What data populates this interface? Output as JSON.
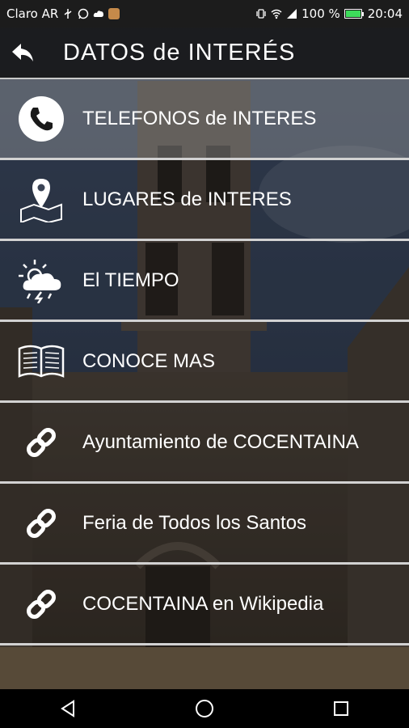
{
  "status_bar": {
    "carrier": "Claro AR",
    "battery_percent": "100 %",
    "battery_level": 1.0,
    "time": "20:04",
    "icons_left": [
      "usb-icon",
      "whatsapp-icon",
      "cloud-icon",
      "app-notification-icon"
    ],
    "icons_right": [
      "vibrate-icon",
      "wifi-icon",
      "signal-icon",
      "battery-icon"
    ]
  },
  "header": {
    "back_icon": "back-arrow-icon",
    "title": "DATOS de INTERÉS"
  },
  "menu": {
    "items": [
      {
        "icon": "phone-icon",
        "label": "TELEFONOS de INTERES"
      },
      {
        "icon": "map-pin-icon",
        "label": "LUGARES de INTERES"
      },
      {
        "icon": "weather-icon",
        "label": "El TIEMPO"
      },
      {
        "icon": "book-icon",
        "label": "CONOCE MAS"
      },
      {
        "icon": "link-icon",
        "label": "Ayuntamiento de COCENTAINA"
      },
      {
        "icon": "link-icon",
        "label": "Feria de Todos los Santos"
      },
      {
        "icon": "link-icon",
        "label": "COCENTAINA en Wikipedia"
      }
    ]
  },
  "nav_bar": {
    "buttons": [
      "back-triangle-icon",
      "home-circle-icon",
      "recents-square-icon"
    ]
  }
}
